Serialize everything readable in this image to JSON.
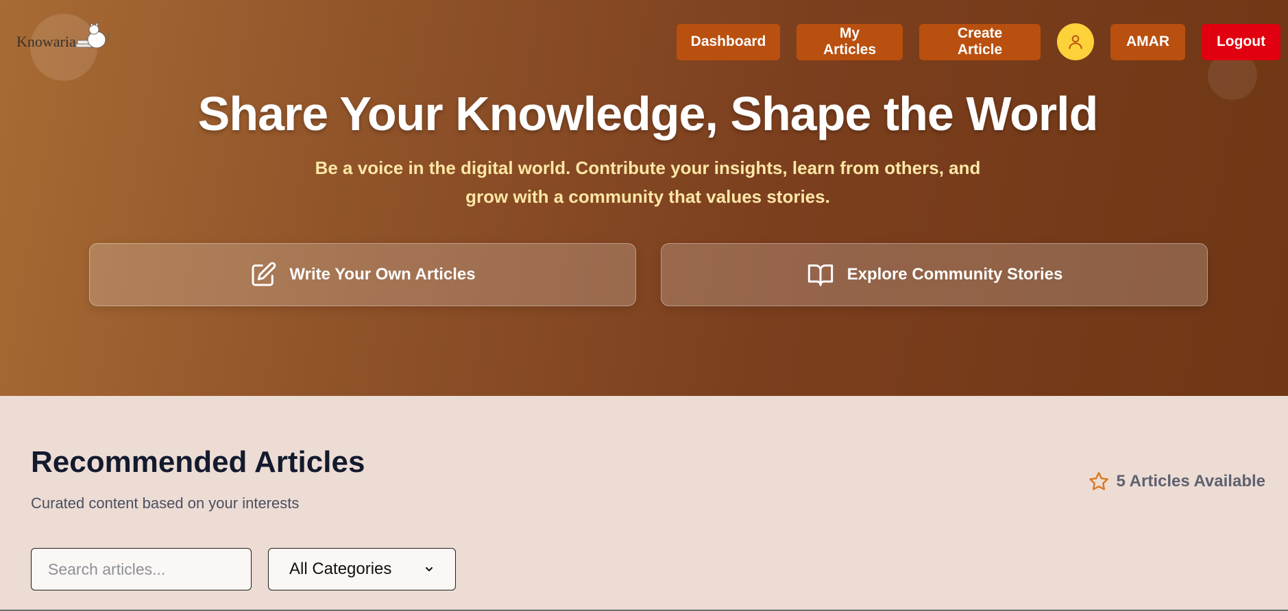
{
  "brand": {
    "name": "Knowaria",
    "logo_icon": "cat-on-books-icon"
  },
  "nav": {
    "dashboard": "Dashboard",
    "my_articles": "My Articles",
    "create_article": "Create Article",
    "avatar_icon": "user-icon",
    "username": "AMAR",
    "logout": "Logout"
  },
  "hero": {
    "title": "Share Your Knowledge, Shape the World",
    "subtitle": "Be a voice in the digital world. Contribute your insights, learn from others, and grow with a community that values stories.",
    "cta_write": {
      "label": "Write Your Own Articles",
      "icon": "edit-icon"
    },
    "cta_explore": {
      "label": "Explore Community Stories",
      "icon": "open-book-icon"
    }
  },
  "recommended": {
    "title": "Recommended Articles",
    "subtitle": "Curated content based on your interests",
    "available_label": "5 Articles Available",
    "available_icon": "star-icon"
  },
  "filters": {
    "search_placeholder": "Search articles...",
    "search_value": "",
    "category_selected": "All Categories"
  },
  "colors": {
    "nav_button": "#b9500f",
    "logout_button": "#e1000f",
    "avatar": "#fdd13a",
    "hero_subtitle": "#fde7a6",
    "page_bg": "#ecdcd4",
    "star": "#d9781f"
  }
}
